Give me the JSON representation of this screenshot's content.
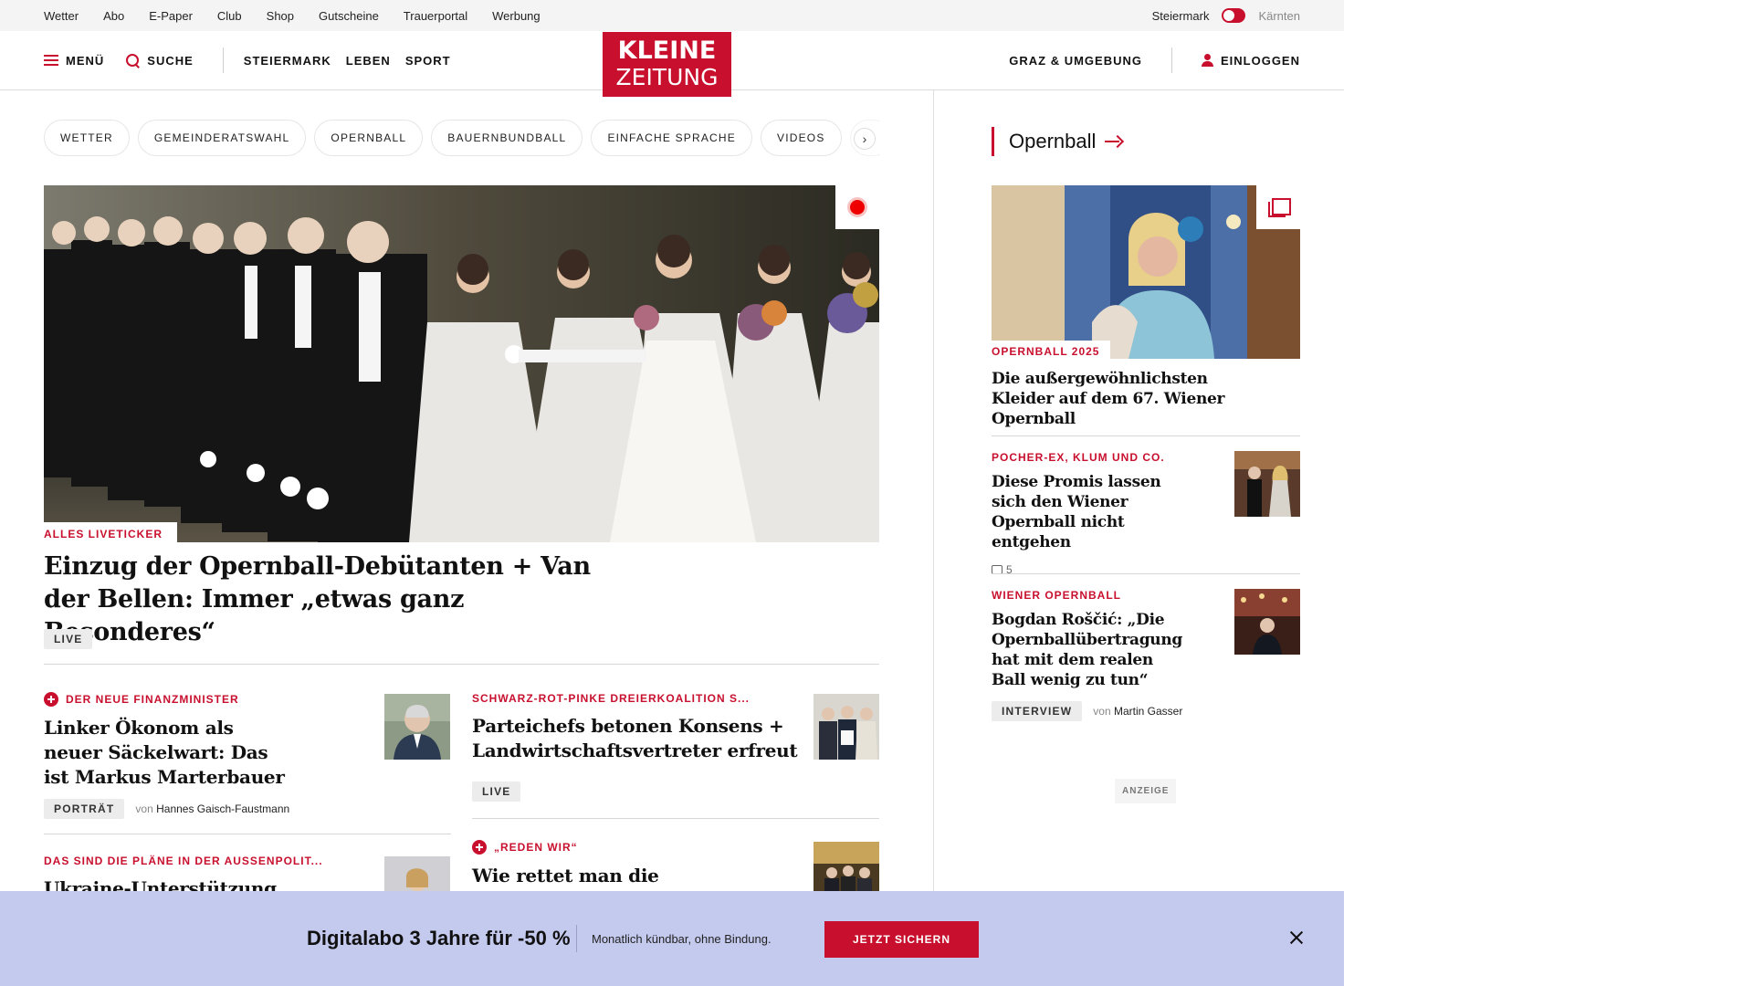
{
  "utility": {
    "links": [
      "Wetter",
      "Abo",
      "E-Paper",
      "Club",
      "Shop",
      "Gutscheine",
      "Trauerportal",
      "Werbung"
    ],
    "region_active": "Steiermark",
    "region_inactive": "Kärnten"
  },
  "header": {
    "menu_label": "MENÜ",
    "search_label": "SUCHE",
    "nav": [
      "STEIERMARK",
      "LEBEN",
      "SPORT"
    ],
    "logo_line1": "KLEINE",
    "logo_line2": "ZEITUNG",
    "region_link": "GRAZ & UMGEBUNG",
    "login_label": "EINLOGGEN"
  },
  "chips": [
    "WETTER",
    "GEMEINDERATSWAHL",
    "OPERNBALL",
    "BAUERNBUNDBALL",
    "EINFACHE SPRACHE",
    "VIDEOS",
    "K"
  ],
  "hero": {
    "kicker": "ALLES LIVETICKER",
    "title": "Einzug der Opernball-Debütanten + Van der Bellen: Immer „etwas ganz Besonderes“",
    "tag": "LIVE"
  },
  "teasers": [
    {
      "kicker": "DER NEUE FINANZMINISTER",
      "title": "Linker Ökonom als neuer Säckelwart: Das ist Markus Marterbauer",
      "tag": "PORTRÄT",
      "by_prefix": "von",
      "author": "Hannes Gaisch-Faustmann"
    },
    {
      "kicker": "SCHWARZ-ROT-PINKE DREIERKOALITION S...",
      "title": "Parteichefs betonen Konsens + Landwirtschaftsvertreter erfreut",
      "tag": "LIVE"
    },
    {
      "kicker": "DAS SIND DIE PLÄNE IN DER AUSSENPOLIT...",
      "title": "Ukraine-Unterstützung, pro"
    },
    {
      "kicker": "„REDEN WIR“",
      "title": "Wie rettet man die"
    }
  ],
  "sidebar": {
    "title": "Opernball",
    "lead": {
      "kicker": "OPERNBALL 2025",
      "title": "Die außergewöhnlichsten Kleider auf dem 67. Wiener Opernball"
    },
    "items": [
      {
        "kicker": "POCHER-EX, KLUM UND CO.",
        "title": "Diese Promis lassen sich den Wiener Opernball nicht entgehen",
        "comments": "5"
      },
      {
        "kicker": "WIENER OPERNBALL",
        "title": "Bogdan Roščić: „Die Opernballübertragung hat mit dem realen Ball wenig zu tun“",
        "tag": "INTERVIEW",
        "by_prefix": "von",
        "author": "Martin Gasser"
      }
    ],
    "ad_label": "ANZEIGE"
  },
  "promo": {
    "headline": "Digitalabo 3 Jahre für -50 %",
    "subline": "Monatlich kündbar, ohne Bindung.",
    "cta": "JETZT SICHERN"
  },
  "colors": {
    "brand_red": "#c8102e",
    "promo_bg": "#c4c9ee",
    "utility_bg": "#f4f4f4"
  }
}
